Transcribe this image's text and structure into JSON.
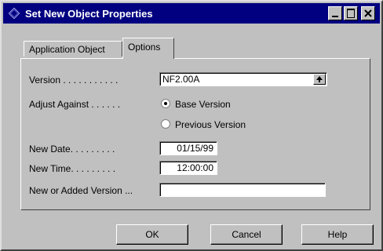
{
  "window": {
    "title": "Set New Object Properties"
  },
  "tabs": [
    {
      "label": "Application Object"
    },
    {
      "label": "Options"
    }
  ],
  "form": {
    "version_label": "Version . . . . . . . . . . .",
    "version_value": "NF2.00A",
    "adjust_label": "Adjust Against . . . . . .",
    "radio_base_label": "Base Version",
    "radio_previous_label": "Previous Version",
    "radio_selected": "Base Version",
    "new_date_label": "New Date. . . . . . . . .",
    "new_date_value": "01/15/99",
    "new_time_label": "New Time. . . . . . . . .",
    "new_time_value": "12:00:00",
    "added_version_label": "New or Added Version ...",
    "added_version_value": ""
  },
  "buttons": {
    "ok": "OK",
    "cancel": "Cancel",
    "help": "Help"
  },
  "colors": {
    "titlebar": "#000080",
    "face": "#c0c0c0"
  }
}
